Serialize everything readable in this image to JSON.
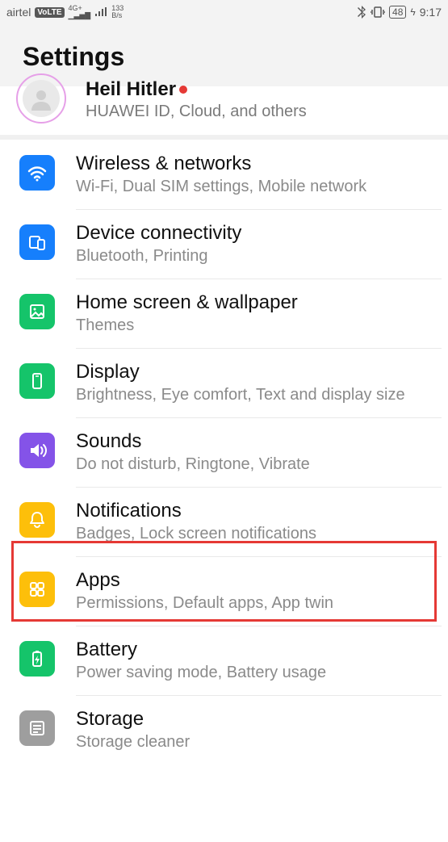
{
  "status": {
    "carrier": "airtel",
    "volte": "VoLTE",
    "net_top": "4G+",
    "rate_top": "133",
    "rate_unit": "B/s",
    "battery": "48",
    "time": "9:17"
  },
  "header": {
    "title": "Settings"
  },
  "account": {
    "name": "Heil Hitler",
    "sub": "HUAWEI ID, Cloud, and others"
  },
  "items": [
    {
      "title": "Wireless & networks",
      "sub": "Wi-Fi, Dual SIM settings, Mobile network"
    },
    {
      "title": "Device connectivity",
      "sub": "Bluetooth, Printing"
    },
    {
      "title": "Home screen & wallpaper",
      "sub": "Themes"
    },
    {
      "title": "Display",
      "sub": "Brightness, Eye comfort, Text and display size"
    },
    {
      "title": "Sounds",
      "sub": "Do not disturb, Ringtone, Vibrate"
    },
    {
      "title": "Notifications",
      "sub": "Badges, Lock screen notifications"
    },
    {
      "title": "Apps",
      "sub": "Permissions, Default apps, App twin"
    },
    {
      "title": "Battery",
      "sub": "Power saving mode, Battery usage"
    },
    {
      "title": "Storage",
      "sub": "Storage cleaner"
    }
  ]
}
